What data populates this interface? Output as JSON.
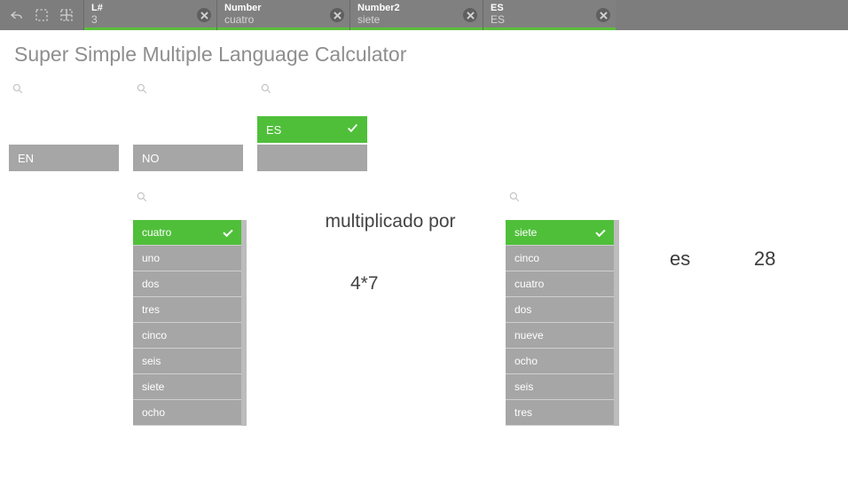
{
  "toolbar": {
    "filters": [
      {
        "label": "L#",
        "value": "3"
      },
      {
        "label": "Number",
        "value": "cuatro"
      },
      {
        "label": "Number2",
        "value": "siete"
      },
      {
        "label": "ES",
        "value": "ES"
      }
    ]
  },
  "title": "Super Simple Multiple Language Calculator",
  "lang_row": {
    "en": "EN",
    "no": "NO",
    "es_selected": "ES"
  },
  "list_left": {
    "selected": "cuatro",
    "items": [
      "uno",
      "dos",
      "tres",
      "cinco",
      "seis",
      "siete",
      "ocho"
    ]
  },
  "operator_label": "multiplicado por",
  "expression": "4*7",
  "list_right": {
    "selected": "siete",
    "items": [
      "cinco",
      "cuatro",
      "dos",
      "nueve",
      "ocho",
      "seis",
      "tres"
    ]
  },
  "equals_word": "es",
  "result": "28"
}
